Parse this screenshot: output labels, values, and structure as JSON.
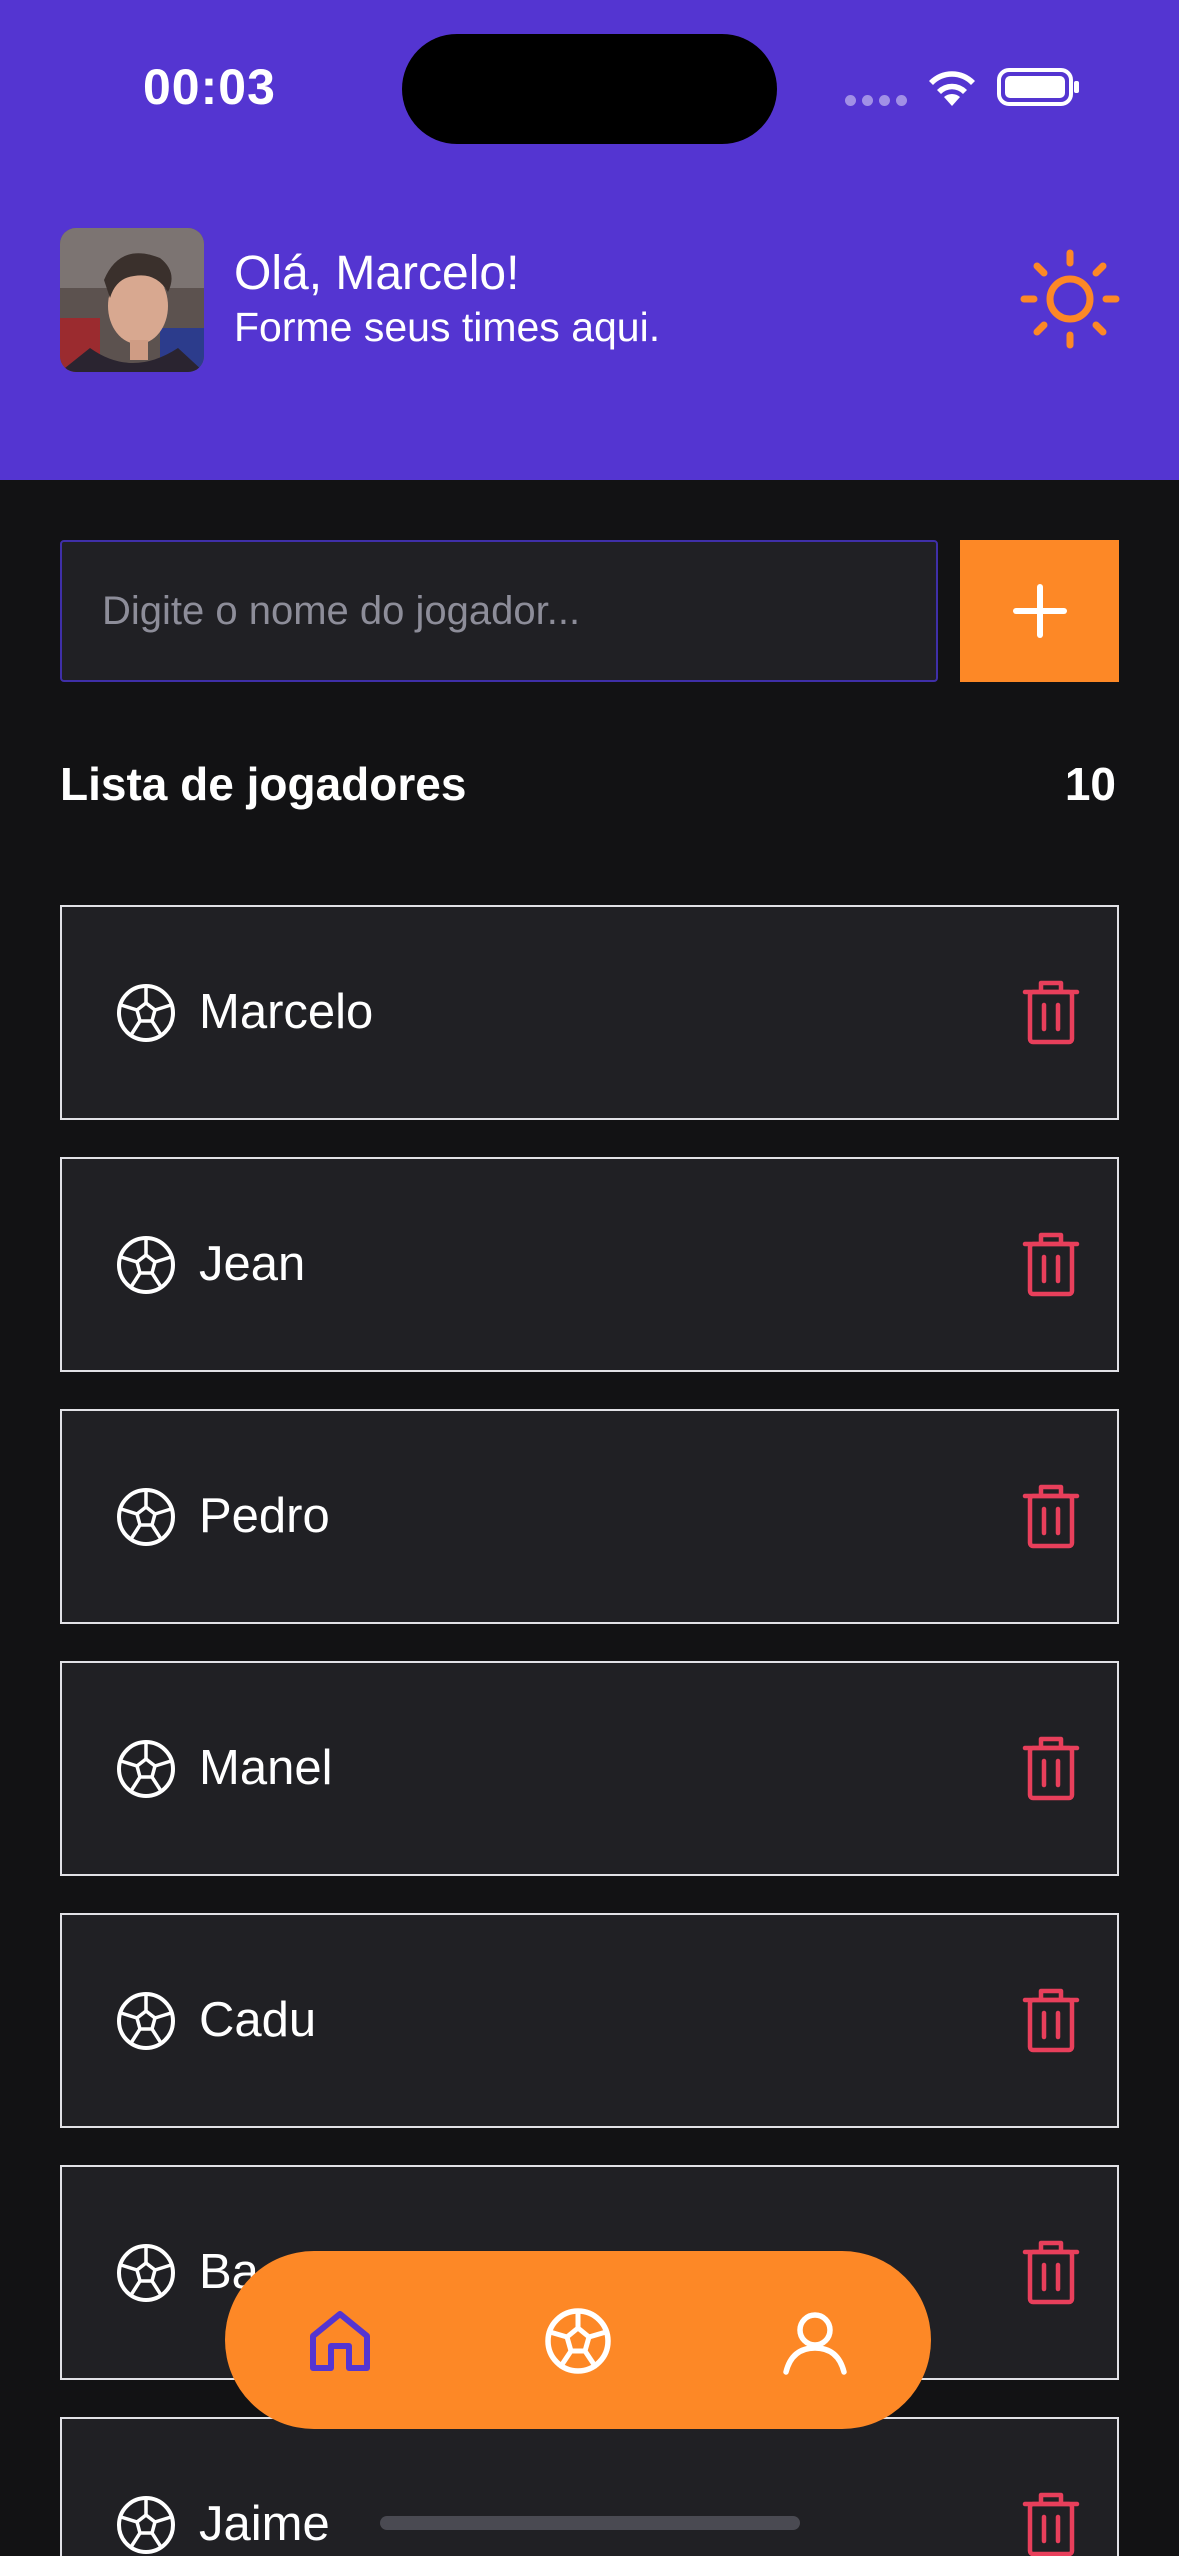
{
  "status_bar": {
    "time": "00:03"
  },
  "header": {
    "greeting": "Olá, Marcelo!",
    "subtitle": "Forme seus times aqui.",
    "theme_icon": "sun-icon"
  },
  "form": {
    "placeholder": "Digite o nome do jogador...",
    "add_icon": "plus-icon"
  },
  "list": {
    "title": "Lista de jogadores",
    "count": "10",
    "players": [
      {
        "name": "Marcelo"
      },
      {
        "name": "Jean"
      },
      {
        "name": "Pedro"
      },
      {
        "name": "Manel"
      },
      {
        "name": "Cadu"
      },
      {
        "name": "Ba"
      },
      {
        "name": "Jaime"
      }
    ]
  },
  "bottom_nav": {
    "items": [
      "home-icon",
      "soccer-ball-icon",
      "user-icon"
    ],
    "active": "home-icon"
  },
  "colors": {
    "header_bg": "#5435d1",
    "accent": "#fd8826",
    "background": "#121214",
    "card": "#202024",
    "danger": "#e83f5b"
  }
}
